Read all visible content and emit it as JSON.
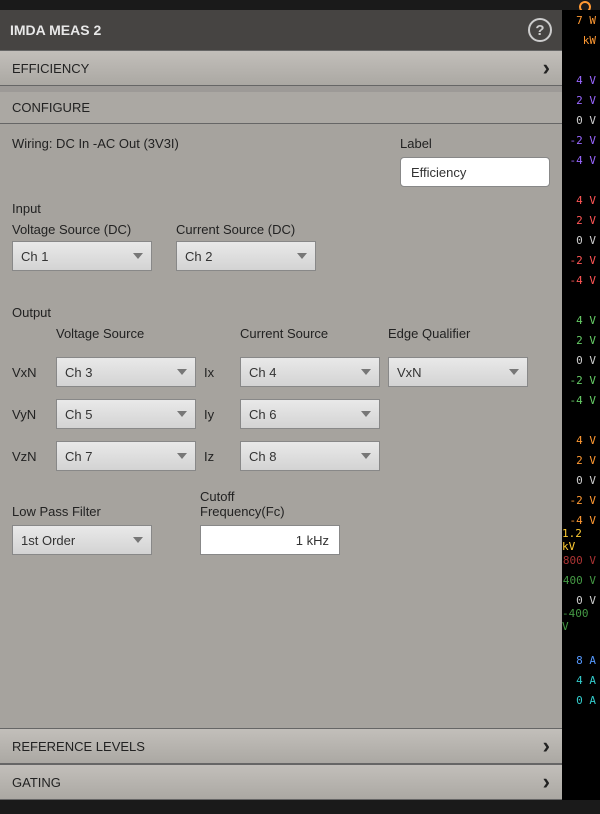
{
  "title": "IMDA MEAS 2",
  "sections": {
    "efficiency": "EFFICIENCY",
    "configure": "CONFIGURE",
    "reference": "REFERENCE LEVELS",
    "gating": "GATING"
  },
  "wiring": "Wiring: DC In -AC Out (3V3I)",
  "label_text": "Label",
  "label_value": "Efficiency",
  "input": {
    "group": "Input",
    "vsrc_label": "Voltage Source (DC)",
    "vsrc": "Ch 1",
    "csrc_label": "Current Source (DC)",
    "csrc": "Ch 2"
  },
  "output": {
    "group": "Output",
    "vsrc_label": "Voltage Source",
    "csrc_label": "Current Source",
    "edge_label": "Edge Qualifier",
    "vxn_label": "VxN",
    "vxn": "Ch 3",
    "ix_label": "Ix",
    "ix": "Ch 4",
    "edge": "VxN",
    "vyn_label": "VyN",
    "vyn": "Ch 5",
    "iy_label": "Iy",
    "iy": "Ch 6",
    "vzn_label": "VzN",
    "vzn": "Ch 7",
    "iz_label": "Iz",
    "iz": "Ch 8"
  },
  "lpf": {
    "label": "Low Pass Filter",
    "value": "1st Order",
    "fc_label": "Cutoff Frequency(Fc)",
    "fc_value": "1 kHz"
  },
  "scale": [
    {
      "t": "7 W",
      "c": "c-orange"
    },
    {
      "t": "kW",
      "c": "c-orange"
    },
    {
      "t": "",
      "c": ""
    },
    {
      "t": "4 V",
      "c": "c-purple"
    },
    {
      "t": "2 V",
      "c": "c-purple"
    },
    {
      "t": "0 V",
      "c": "c-white"
    },
    {
      "t": "-2 V",
      "c": "c-purple"
    },
    {
      "t": "-4 V",
      "c": "c-purple"
    },
    {
      "t": "",
      "c": ""
    },
    {
      "t": "4 V",
      "c": "c-red"
    },
    {
      "t": "2 V",
      "c": "c-red"
    },
    {
      "t": "0 V",
      "c": "c-white"
    },
    {
      "t": "-2 V",
      "c": "c-red"
    },
    {
      "t": "-4 V",
      "c": "c-red"
    },
    {
      "t": "",
      "c": ""
    },
    {
      "t": "4 V",
      "c": "c-green"
    },
    {
      "t": "2 V",
      "c": "c-green"
    },
    {
      "t": "0 V",
      "c": "c-white"
    },
    {
      "t": "-2 V",
      "c": "c-green"
    },
    {
      "t": "-4 V",
      "c": "c-green"
    },
    {
      "t": "",
      "c": ""
    },
    {
      "t": "4 V",
      "c": "c-orange"
    },
    {
      "t": "2 V",
      "c": "c-orange"
    },
    {
      "t": "0 V",
      "c": "c-white"
    },
    {
      "t": "-2 V",
      "c": "c-orange"
    },
    {
      "t": "-4 V",
      "c": "c-orange"
    },
    {
      "t": "1.2 kV",
      "c": "c-yellow"
    },
    {
      "t": "800 V",
      "c": "c-dred"
    },
    {
      "t": "400 V",
      "c": "c-dgreen"
    },
    {
      "t": "0 V",
      "c": "c-white"
    },
    {
      "t": "-400 V",
      "c": "c-dgreen"
    },
    {
      "t": "",
      "c": ""
    },
    {
      "t": "8 A",
      "c": "c-blue"
    },
    {
      "t": "4 A",
      "c": "c-cyan"
    },
    {
      "t": "0 A",
      "c": "c-cyan"
    },
    {
      "t": "",
      "c": ""
    }
  ]
}
